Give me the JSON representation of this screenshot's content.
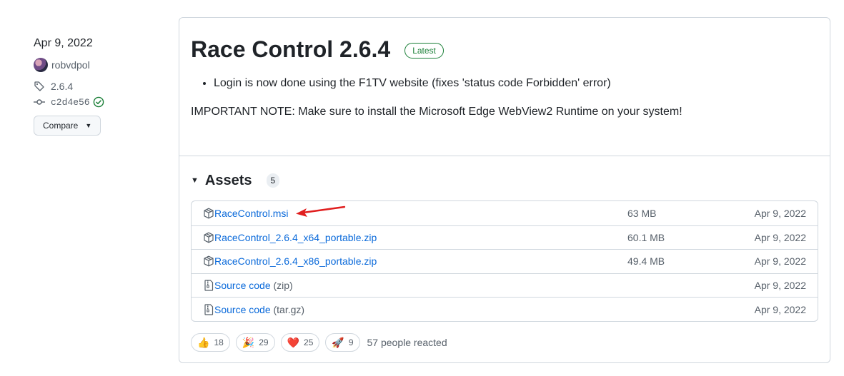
{
  "meta": {
    "date": "Apr 9, 2022",
    "author": "robvdpol",
    "tag": "2.6.4",
    "commit": "c2d4e56",
    "compare_label": "Compare"
  },
  "release": {
    "title": "Race Control 2.6.4",
    "badge": "Latest",
    "bullet": "Login is now done using the F1TV website (fixes 'status code Forbidden' error)",
    "note": "IMPORTANT NOTE: Make sure to install the Microsoft Edge WebView2 Runtime on your system!"
  },
  "assets": {
    "label": "Assets",
    "count": "5",
    "items": [
      {
        "name": "RaceControl.msi",
        "size": "63 MB",
        "date": "Apr 9, 2022",
        "icon": "package-icon"
      },
      {
        "name": "RaceControl_2.6.4_x64_portable.zip",
        "size": "60.1 MB",
        "date": "Apr 9, 2022",
        "icon": "package-icon"
      },
      {
        "name": "RaceControl_2.6.4_x86_portable.zip",
        "size": "49.4 MB",
        "date": "Apr 9, 2022",
        "icon": "package-icon"
      },
      {
        "name": "Source code",
        "suffix": "(zip)",
        "size": "",
        "date": "Apr 9, 2022",
        "icon": "file-zip-icon"
      },
      {
        "name": "Source code",
        "suffix": "(tar.gz)",
        "size": "",
        "date": "Apr 9, 2022",
        "icon": "file-zip-icon"
      }
    ]
  },
  "reactions": {
    "items": [
      {
        "emoji": "👍",
        "count": "18",
        "icon": "thumbs-up-icon"
      },
      {
        "emoji": "🎉",
        "count": "29",
        "icon": "tada-icon"
      },
      {
        "emoji": "❤️",
        "count": "25",
        "icon": "heart-icon"
      },
      {
        "emoji": "🚀",
        "count": "9",
        "icon": "rocket-icon"
      }
    ],
    "summary": "57 people reacted"
  },
  "colors": {
    "link": "#0969da",
    "latest": "#1a7f37",
    "arrow": "#e01e1e",
    "border": "#d0d7de"
  }
}
